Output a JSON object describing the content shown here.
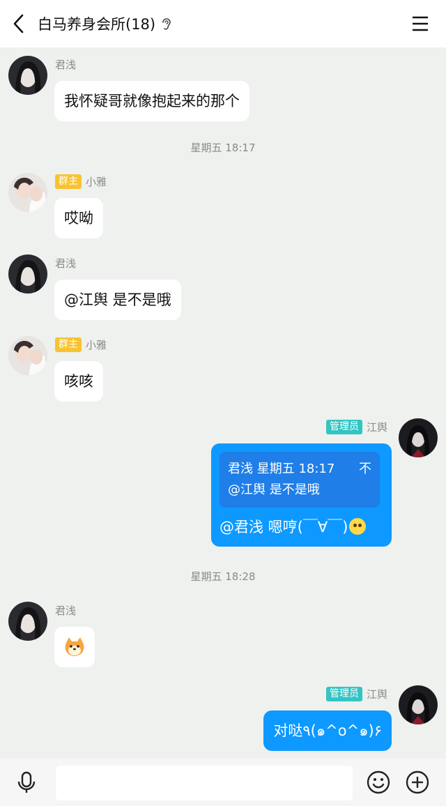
{
  "header": {
    "title": "白马养身会所(18)",
    "icons": {
      "back": "back-arrow-icon",
      "ear": "ear-icon",
      "menu": "menu-icon"
    }
  },
  "messages": [
    {
      "sender": "君浅",
      "text": "我怀疑哥就像抱起来的那个"
    },
    {
      "timestamp": "星期五 18:17"
    },
    {
      "badge": "群主",
      "sender": "小雅",
      "text": "哎呦"
    },
    {
      "sender": "君浅",
      "text": "@江舆 是不是哦"
    },
    {
      "badge": "群主",
      "sender": "小雅",
      "text": "咳咳"
    },
    {
      "badge": "管理员",
      "sender": "江舆",
      "quote": {
        "header": "君浅 星期五 18:17",
        "close": "不",
        "text": "@江舆 是不是哦"
      },
      "text": "@君浅 嗯哼(￣∀￣)"
    },
    {
      "timestamp": "星期五 18:28"
    },
    {
      "sender": "君浅",
      "sticker": "shiba-sticker-icon"
    },
    {
      "badge": "管理员",
      "sender": "江舆",
      "text": "对哒٩(๑^o^๑)۶"
    }
  ],
  "input": {
    "placeholder": ""
  },
  "colors": {
    "my_bubble": "#0d99ff",
    "owner_badge": "#f7c331",
    "admin_badge": "#33c4c4",
    "background": "#eef1ee"
  }
}
